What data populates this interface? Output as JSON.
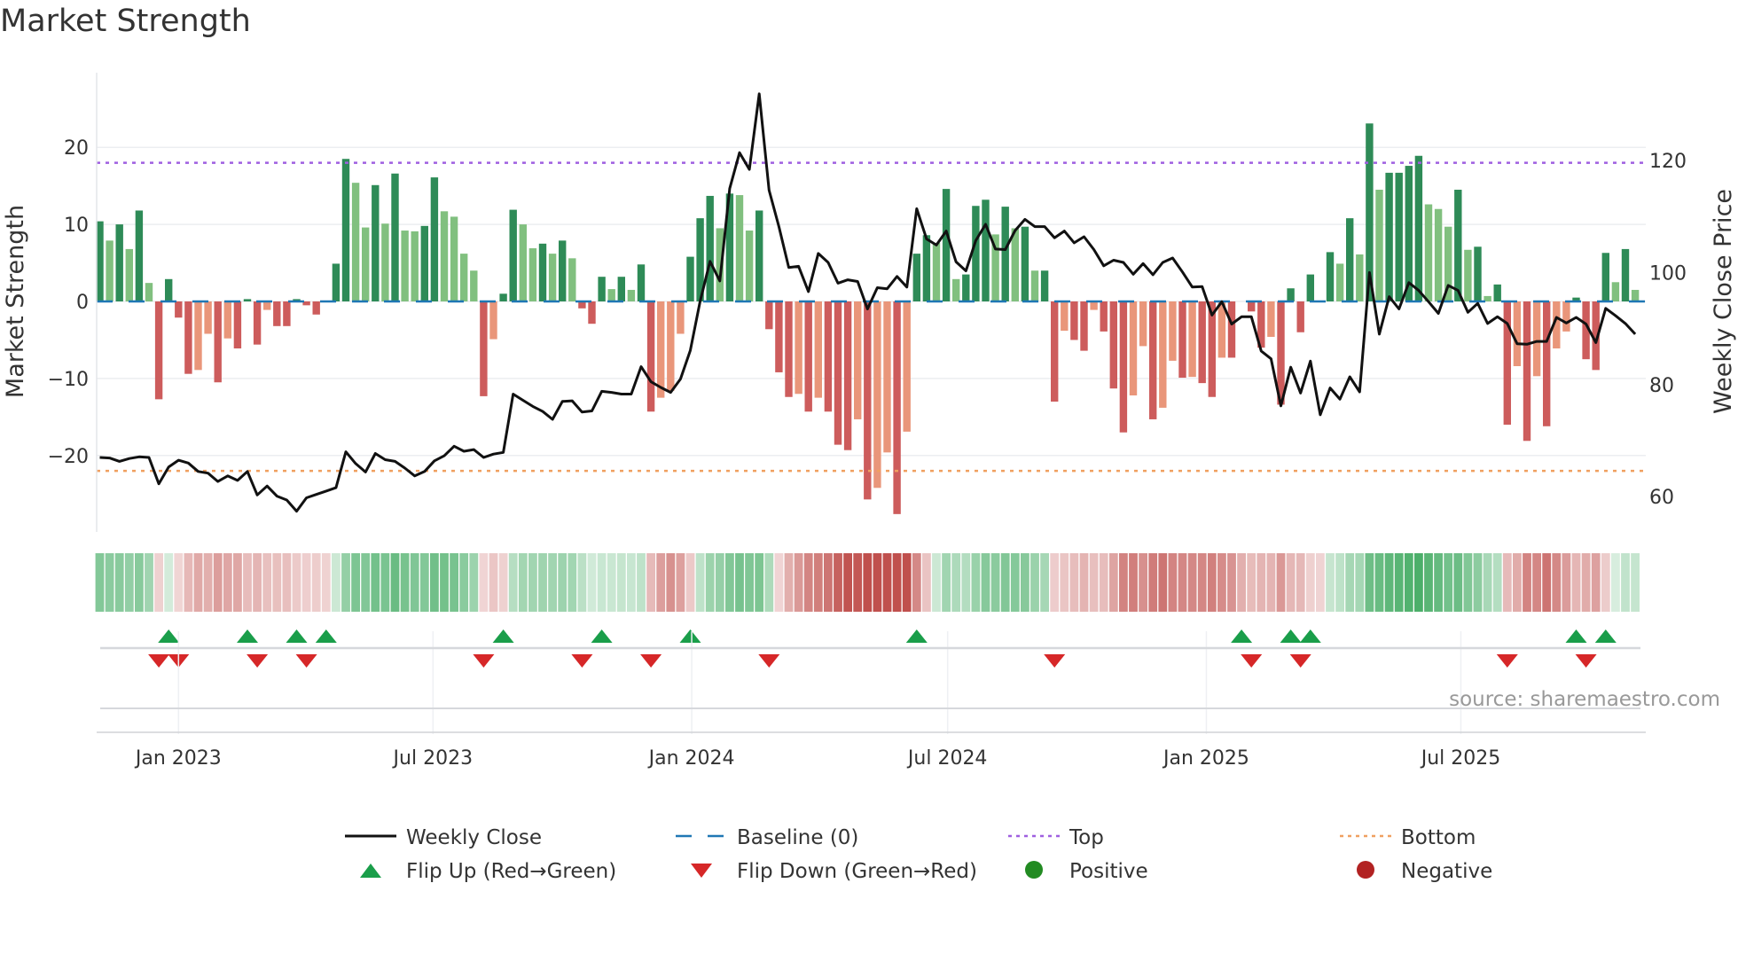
{
  "title": "Market Strength",
  "source": "source: sharemaestro.com",
  "chart_data": {
    "type": "bar",
    "title": "Market Strength",
    "ylabel": "Market Strength",
    "y2label": "Weekly Close Price",
    "ylim": [
      -28.5,
      28
    ],
    "y2lim": [
      56,
      135
    ],
    "yticks": [
      -20,
      -10,
      0,
      10,
      20
    ],
    "ytick_labels": [
      "−20",
      "−10",
      "0",
      "10",
      "20"
    ],
    "y2ticks": [
      60,
      80,
      100,
      120
    ],
    "y2tick_labels": [
      "60",
      "80",
      "100",
      "120"
    ],
    "x_start": "2022-11-06",
    "x_step_days": 7,
    "xticks": [
      {
        "date": "2023-01-01",
        "label": "Jan 2023"
      },
      {
        "date": "2023-07-01",
        "label": "Jul 2023"
      },
      {
        "date": "2024-01-01",
        "label": "Jan 2024"
      },
      {
        "date": "2024-07-01",
        "label": "Jul 2024"
      },
      {
        "date": "2025-01-01",
        "label": "Jan 2025"
      },
      {
        "date": "2025-07-01",
        "label": "Jul 2025"
      }
    ],
    "top_level": 18,
    "bottom_level": -22,
    "baseline": 0,
    "grid": true,
    "strength": [
      10.4,
      7.9,
      10.0,
      6.8,
      11.8,
      2.4,
      -12.7,
      2.9,
      -2.1,
      -9.4,
      -8.9,
      -4.2,
      -10.5,
      -4.8,
      -6.1,
      0.3,
      -5.6,
      -1.1,
      -3.2,
      -3.2,
      0.3,
      -0.5,
      -1.7,
      0,
      4.9,
      18.5,
      15.4,
      9.6,
      15.1,
      10.1,
      16.6,
      9.2,
      9.1,
      9.8,
      16.1,
      11.7,
      11.0,
      6.2,
      4.0,
      -12.3,
      -4.9,
      1.0,
      11.9,
      10.0,
      6.9,
      7.5,
      6.2,
      7.9,
      5.6,
      -0.9,
      -2.9,
      3.2,
      1.6,
      3.2,
      1.5,
      4.8,
      -14.3,
      -12.5,
      -11.6,
      -4.2,
      5.8,
      10.8,
      13.7,
      9.5,
      14.0,
      13.8,
      9.2,
      11.8,
      -3.6,
      -9.2,
      -12.4,
      -12.0,
      -14.3,
      -12.5,
      -14.3,
      -18.6,
      -19.3,
      -15.3,
      -25.7,
      -24.2,
      -19.6,
      -27.6,
      -16.9,
      6.2,
      8.6,
      7.6,
      14.6,
      2.9,
      3.5,
      12.4,
      13.2,
      8.7,
      12.3,
      9.5,
      9.7,
      4.0,
      4.0,
      -13.0,
      -3.8,
      -5.0,
      -6.4,
      -1.1,
      -3.9,
      -11.3,
      -17.0,
      -12.2,
      -5.8,
      -15.3,
      -13.8,
      -7.7,
      -9.9,
      -9.8,
      -10.6,
      -12.4,
      -7.3,
      -7.3,
      0,
      -1.3,
      -6.0,
      -4.6,
      -13.4,
      1.7,
      -4.0,
      3.5,
      0,
      6.4,
      4.9,
      10.8,
      6.1,
      23.1,
      14.5,
      16.7,
      16.7,
      17.6,
      18.9,
      12.6,
      12.0,
      9.7,
      14.5,
      6.7,
      7.1,
      0.7,
      2.2,
      -16.0,
      -8.4,
      -18.1,
      -9.7,
      -16.2,
      -6.1,
      -3.9,
      0.5,
      -7.5,
      -8.9,
      6.3,
      2.5,
      6.8,
      1.5
    ],
    "weekly_close": [
      67.0,
      66.9,
      66.3,
      66.8,
      67.1,
      67.0,
      62.3,
      65.3,
      66.5,
      66.0,
      64.5,
      64.2,
      62.7,
      63.7,
      62.9,
      64.5,
      60.3,
      61.9,
      60.1,
      59.4,
      57.4,
      59.8,
      60.4,
      61.0,
      61.6,
      68.0,
      65.9,
      64.4,
      67.7,
      66.6,
      66.3,
      65.1,
      63.7,
      64.5,
      66.4,
      67.3,
      69.0,
      68.1,
      68.4,
      67.0,
      67.6,
      67.9,
      78.3,
      77.2,
      76.1,
      75.2,
      73.8,
      77.0,
      77.1,
      75.1,
      75.3,
      78.8,
      78.6,
      78.3,
      78.3,
      83.2,
      80.5,
      79.5,
      78.6,
      81.0,
      86.1,
      94.9,
      102.0,
      98.5,
      115.0,
      121.4,
      118.4,
      131.9,
      114.7,
      108.2,
      100.9,
      101.1,
      96.6,
      103.4,
      101.8,
      98.1,
      98.7,
      98.4,
      93.5,
      97.3,
      97.1,
      99.3,
      97.4,
      111.4,
      106.0,
      104.9,
      107.4,
      101.9,
      100.3,
      105.7,
      108.6,
      104.2,
      104.1,
      107.5,
      109.5,
      108.2,
      108.2,
      106.2,
      107.4,
      105.3,
      106.4,
      104.1,
      101.2,
      102.2,
      101.8,
      99.7,
      101.6,
      99.6,
      101.8,
      102.6,
      100.1,
      97.4,
      97.5,
      92.4,
      94.8,
      90.8,
      92.1,
      92.1,
      86.0,
      84.6,
      76.2,
      83.1,
      78.5,
      84.2,
      74.6,
      79.4,
      77.4,
      81.4,
      78.7,
      100.0,
      89.0,
      95.7,
      93.5,
      98.2,
      96.8,
      94.8,
      92.7,
      97.7,
      96.8,
      92.9,
      94.5,
      90.9,
      92.1,
      90.9,
      87.3,
      87.2,
      87.7,
      87.7,
      92.0,
      91.0,
      92.0,
      90.8,
      87.5,
      93.6,
      92.3,
      90.9,
      89.0
    ],
    "flip_up_weeks": [
      7,
      15,
      20,
      23,
      41,
      51,
      60,
      83,
      116,
      121,
      123,
      150,
      153
    ],
    "flip_down_weeks": [
      6,
      8,
      16,
      21,
      39,
      49,
      56,
      68,
      97,
      117,
      122,
      143,
      151
    ],
    "colors": {
      "pos_rising": "#2e8b57",
      "pos_falling": "#81c07f",
      "neg_falling": "#cd5c5c",
      "neg_rising": "#e9967a",
      "close": "#111111",
      "baseline": "#1f77b4",
      "top": "#9f5fe0",
      "bottom": "#f0a060",
      "flip_up": "#1a9e4a",
      "flip_down": "#d62728",
      "positive": "#228b22",
      "negative": "#b22222",
      "strip_pos": "#4caf6a",
      "strip_neg": "#c0504d"
    },
    "legend_position": "bottom",
    "legend": [
      {
        "label": "Weekly Close",
        "kind": "line"
      },
      {
        "label": "Baseline (0)",
        "kind": "dash"
      },
      {
        "label": "Top",
        "kind": "dot-top"
      },
      {
        "label": "Bottom",
        "kind": "dot-bottom"
      },
      {
        "label": "Flip Up (Red→Green)",
        "kind": "tri-up"
      },
      {
        "label": "Flip Down (Green→Red)",
        "kind": "tri-down"
      },
      {
        "label": "Positive",
        "kind": "dot-pos"
      },
      {
        "label": "Negative",
        "kind": "dot-neg"
      }
    ]
  }
}
